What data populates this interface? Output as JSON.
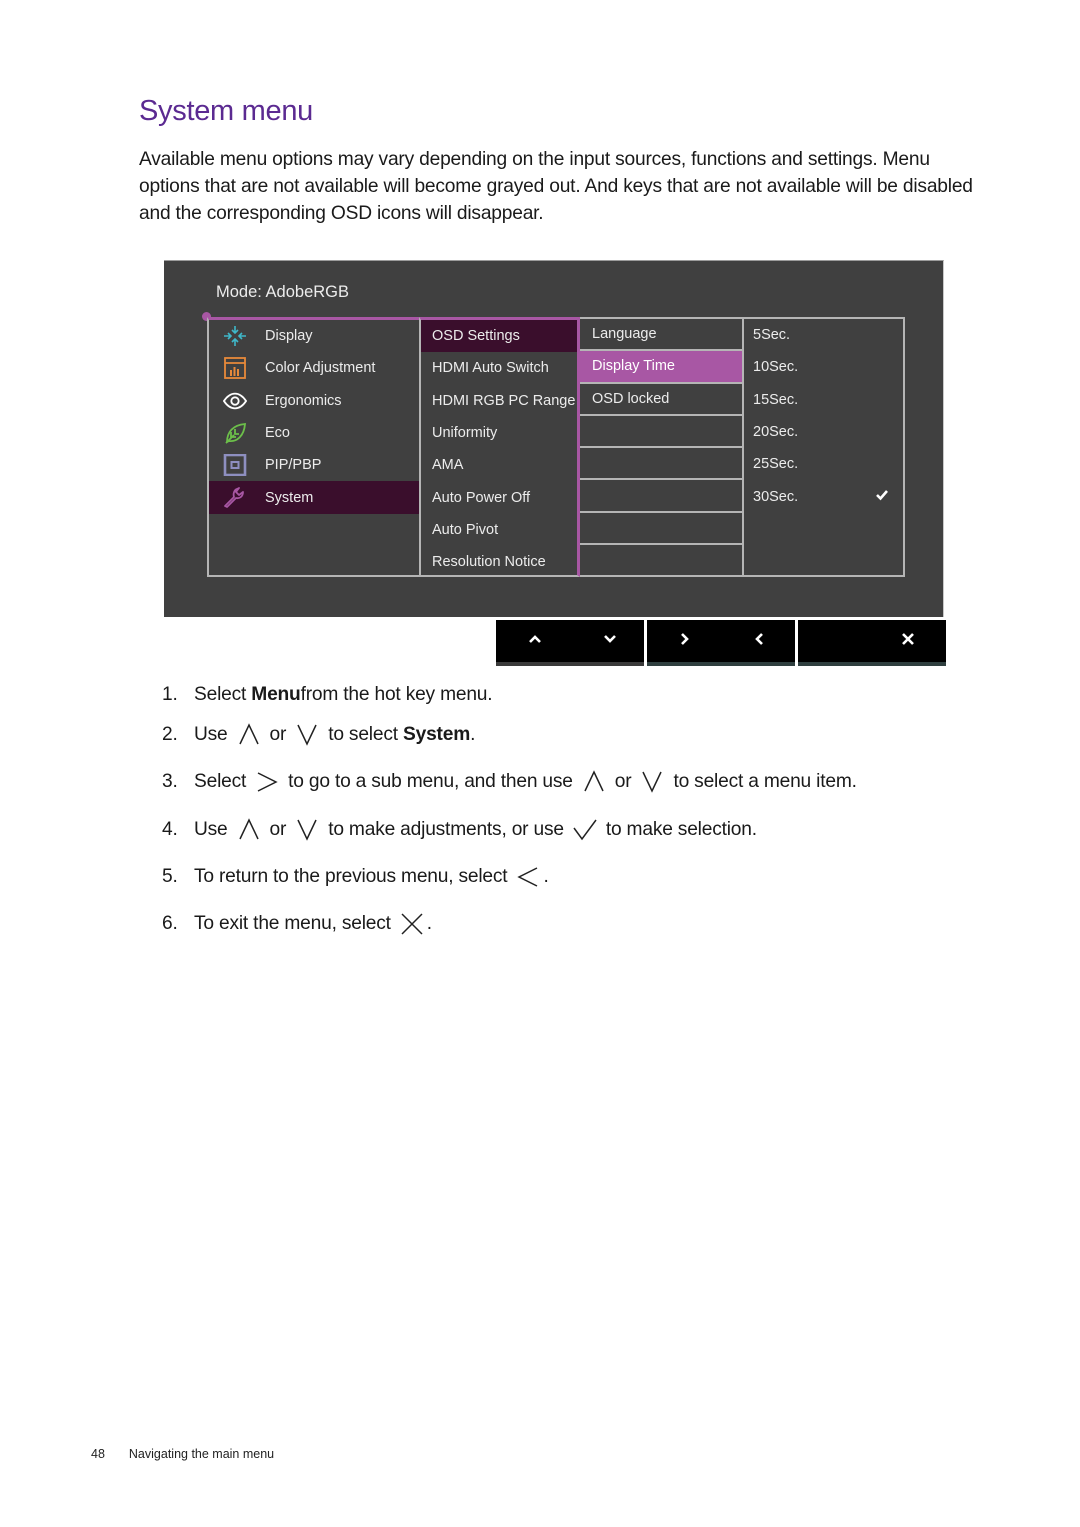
{
  "page": {
    "title": "System menu",
    "intro": "Available menu options may vary depending on the input sources, functions and settings. Menu options that are not available will become grayed out. And keys that are not available will be disabled and the corresponding OSD icons will disappear."
  },
  "osd": {
    "mode_label": "Mode: AdobeRGB",
    "main_menu": [
      {
        "label": "Display",
        "icon": "display-icon",
        "color": "#3fb8c9"
      },
      {
        "label": "Color Adjustment",
        "icon": "color-adjustment-icon",
        "color": "#e8893a"
      },
      {
        "label": "Ergonomics",
        "icon": "eye-icon",
        "color": "#ffffff"
      },
      {
        "label": "Eco",
        "icon": "leaf-icon",
        "color": "#6cbf4a"
      },
      {
        "label": "PIP/PBP",
        "icon": "pip-icon",
        "color": "#8e8fc0"
      },
      {
        "label": "System",
        "icon": "wrench-icon",
        "color": "#a857a4",
        "selected": true
      }
    ],
    "system_menu": [
      {
        "label": "OSD Settings",
        "selected": true
      },
      {
        "label": "HDMI Auto Switch"
      },
      {
        "label": "HDMI RGB PC Range"
      },
      {
        "label": "Uniformity"
      },
      {
        "label": "AMA"
      },
      {
        "label": "Auto Power Off"
      },
      {
        "label": "Auto Pivot"
      },
      {
        "label": "Resolution Notice"
      }
    ],
    "osd_settings_menu": [
      {
        "label": "Language"
      },
      {
        "label": "Display Time",
        "selected": true
      },
      {
        "label": "OSD locked"
      },
      {
        "label": ""
      },
      {
        "label": ""
      },
      {
        "label": ""
      },
      {
        "label": ""
      },
      {
        "label": ""
      }
    ],
    "display_time_options": [
      {
        "label": "5Sec."
      },
      {
        "label": "10Sec."
      },
      {
        "label": "15Sec."
      },
      {
        "label": "20Sec."
      },
      {
        "label": "25Sec."
      },
      {
        "label": "30Sec.",
        "checked": true
      }
    ],
    "keys": [
      "up-key",
      "down-key",
      "right-key",
      "left-key",
      "close-key"
    ],
    "accent_color": "#a857a4",
    "selected_dark_color": "#3a0e2c"
  },
  "steps": [
    {
      "num": "1.",
      "parts": [
        "Select ",
        "Menu",
        " from the hot key menu."
      ]
    },
    {
      "num": "2.",
      "parts": [
        "Use",
        "or",
        "to select ",
        "System",
        "."
      ]
    },
    {
      "num": "3.",
      "parts": [
        "Select",
        "to go to a sub menu, and then use",
        "or",
        "to select a menu item."
      ]
    },
    {
      "num": "4.",
      "parts": [
        "Use",
        "or",
        "to make adjustments, or use",
        "to make selection."
      ]
    },
    {
      "num": "5.",
      "parts": [
        "To return to the previous menu, select",
        "."
      ]
    },
    {
      "num": "6.",
      "parts": [
        "To exit the menu, select",
        "."
      ]
    }
  ],
  "footer": {
    "page_number": "48",
    "section": "Navigating the main menu"
  }
}
